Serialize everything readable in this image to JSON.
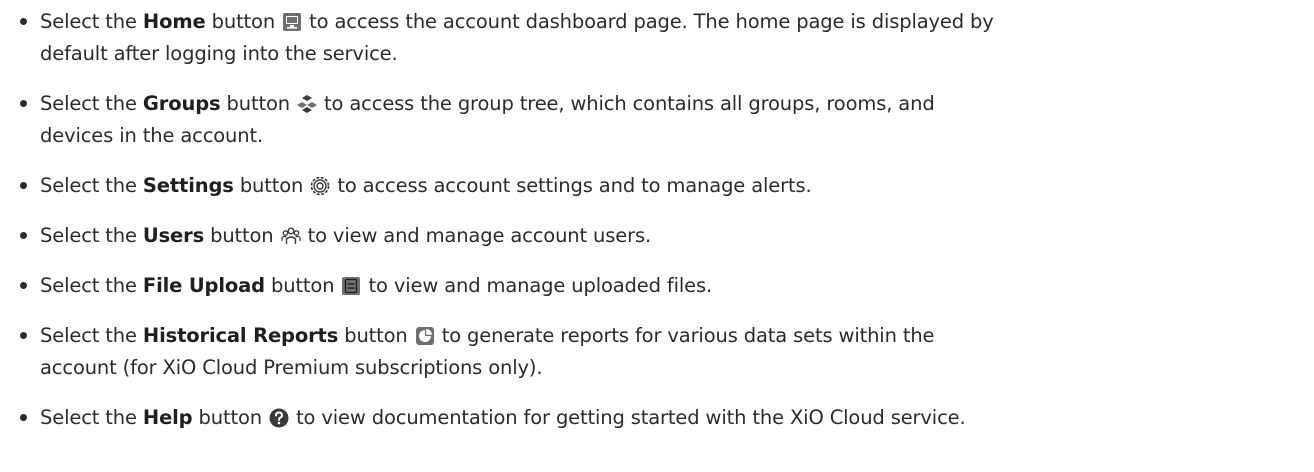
{
  "items": [
    {
      "pre": "Select the ",
      "name": "Home",
      "mid": " button ",
      "icon": "monitor-icon",
      "line1": " to access the account dashboard page. The home page is displayed by",
      "line2": "default after logging into the service."
    },
    {
      "pre": "Select the ",
      "name": "Groups",
      "mid": " button ",
      "icon": "group-tree-icon",
      "line1": " to access the group tree, which contains all groups, rooms, and",
      "line2": "devices in the account."
    },
    {
      "pre": "Select the ",
      "name": "Settings",
      "mid": " button ",
      "icon": "gear-icon",
      "line1": " to access account settings and to manage alerts."
    },
    {
      "pre": "Select the ",
      "name": "Users",
      "mid": " button ",
      "icon": "users-icon",
      "line1": " to view and manage account users."
    },
    {
      "pre": "Select the ",
      "name": "File Upload",
      "mid": " button ",
      "icon": "file-upload-icon",
      "line1": " to view and manage uploaded files."
    },
    {
      "pre": "Select the ",
      "name": "Historical Reports",
      "mid": " button ",
      "icon": "pie-chart-icon",
      "line1": " to generate reports for various data sets within the",
      "line2": "account (for XiO Cloud Premium subscriptions only)."
    },
    {
      "pre": "Select the ",
      "name": "Help",
      "mid": " button ",
      "icon": "help-icon",
      "line1": " to view documentation for getting started with the XiO Cloud service."
    }
  ],
  "colors": {
    "text": "#2b2b2b",
    "icon_dark": "#3a3a3a",
    "icon_fill": "#6f6f6f"
  }
}
